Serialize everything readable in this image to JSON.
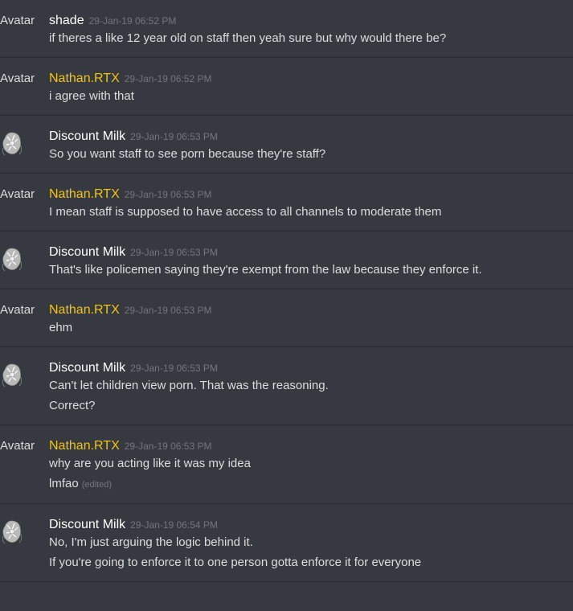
{
  "messages": [
    {
      "avatar": "text",
      "avatar_label": "Avatar",
      "author": "shade",
      "author_color": "#ffffff",
      "timestamp": "29-Jan-19 06:52 PM",
      "lines": [
        {
          "text": "if theres a like 12 year old on staff then yeah sure but why would there be?"
        }
      ]
    },
    {
      "avatar": "text",
      "avatar_label": "Avatar",
      "author": "Nathan.RTX",
      "author_color": "#f1c40f",
      "timestamp": "29-Jan-19 06:52 PM",
      "lines": [
        {
          "text": "i agree with that"
        }
      ]
    },
    {
      "avatar": "image",
      "author": "Discount Milk",
      "author_color": "#ffffff",
      "timestamp": "29-Jan-19 06:53 PM",
      "lines": [
        {
          "text": "So you want staff to see porn because they're staff?"
        }
      ]
    },
    {
      "avatar": "text",
      "avatar_label": "Avatar",
      "author": "Nathan.RTX",
      "author_color": "#f1c40f",
      "timestamp": "29-Jan-19 06:53 PM",
      "lines": [
        {
          "text": "I mean staff is supposed to have access to all channels to moderate them"
        }
      ]
    },
    {
      "avatar": "image",
      "author": "Discount Milk",
      "author_color": "#ffffff",
      "timestamp": "29-Jan-19 06:53 PM",
      "lines": [
        {
          "text": "That's like policemen saying they're exempt from the law because they enforce it."
        }
      ]
    },
    {
      "avatar": "text",
      "avatar_label": "Avatar",
      "author": "Nathan.RTX",
      "author_color": "#f1c40f",
      "timestamp": "29-Jan-19 06:53 PM",
      "lines": [
        {
          "text": "ehm"
        }
      ]
    },
    {
      "avatar": "image",
      "author": "Discount Milk",
      "author_color": "#ffffff",
      "timestamp": "29-Jan-19 06:53 PM",
      "lines": [
        {
          "text": "Can't let children view porn. That was the reasoning."
        },
        {
          "text": "Correct?"
        }
      ]
    },
    {
      "avatar": "text",
      "avatar_label": "Avatar",
      "author": "Nathan.RTX",
      "author_color": "#f1c40f",
      "timestamp": "29-Jan-19 06:53 PM",
      "lines": [
        {
          "text": "why are you acting like it was my idea"
        },
        {
          "text": "lmfao",
          "edited": "(edited)"
        }
      ]
    },
    {
      "avatar": "image",
      "author": "Discount Milk",
      "author_color": "#ffffff",
      "timestamp": "29-Jan-19 06:54 PM",
      "lines": [
        {
          "text": "No, I'm just arguing the logic behind it."
        },
        {
          "text": "If you're going to enforce it to one person gotta enforce it for everyone"
        }
      ]
    }
  ],
  "colors": {
    "background": "#36393f",
    "divider": "#2a2c31",
    "timestamp": "#72767d",
    "role_gold": "#f1c40f"
  },
  "icons": {
    "avatar_image": "avatar-icon"
  }
}
